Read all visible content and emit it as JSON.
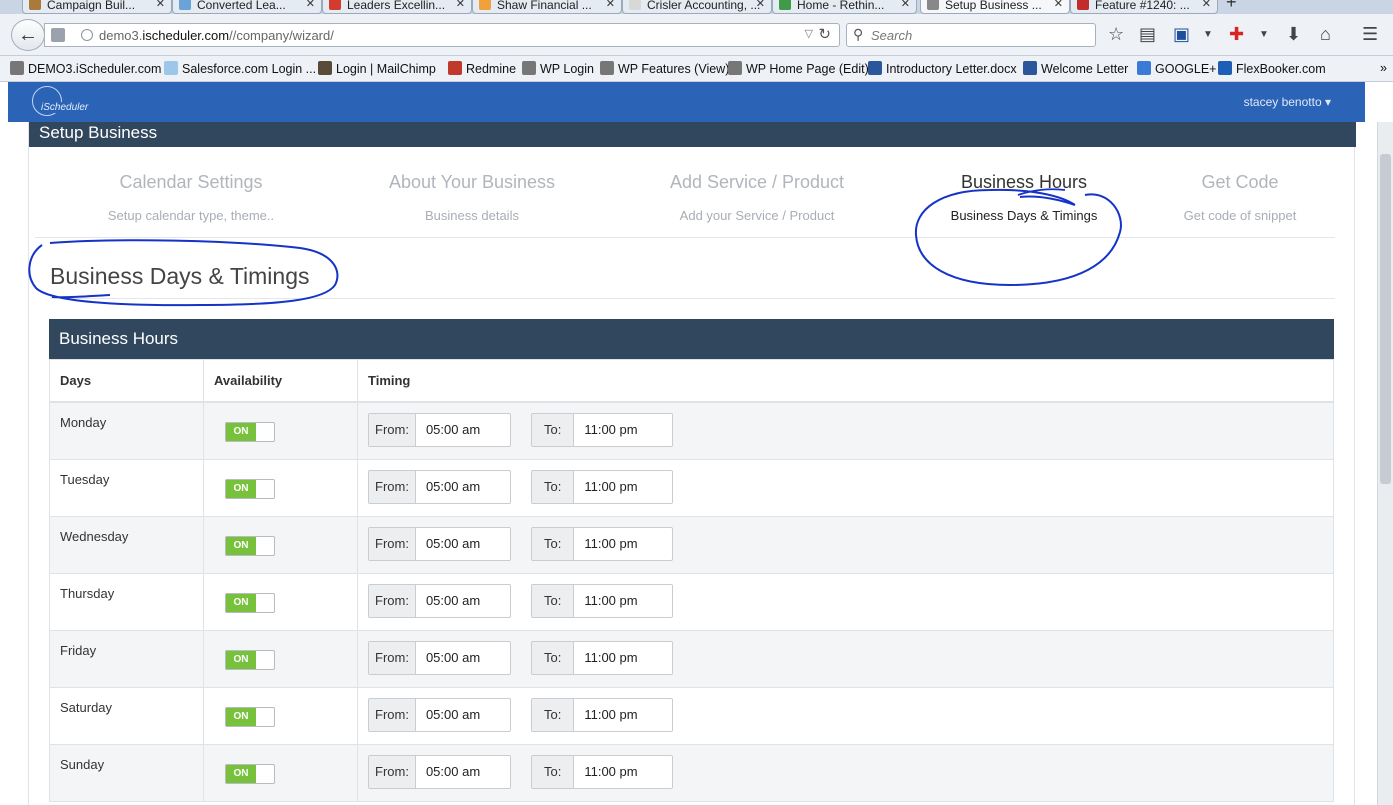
{
  "browser": {
    "tabs": [
      {
        "title": "Campaign Buil...",
        "fav": "#a97a3c"
      },
      {
        "title": "Converted Lea...",
        "fav": "#6aa3d8"
      },
      {
        "title": "Leaders Excellin...",
        "fav": "#d33b2c"
      },
      {
        "title": "Shaw Financial ...",
        "fav": "#f0a13a"
      },
      {
        "title": "Crisler Accounting, ...",
        "fav": "#d8d8d8"
      },
      {
        "title": "Home - Rethin...",
        "fav": "#3f9a4a"
      },
      {
        "title": "Setup Business ...",
        "fav": "#888888"
      },
      {
        "title": "Feature #1240: ...",
        "fav": "#c12d2d"
      }
    ],
    "new_tab": "+",
    "url_host": "demo3.",
    "url_domain": "ischeduler.com",
    "url_path": "//company/wizard/",
    "search_placeholder": "Search",
    "bookmarks": [
      {
        "label": "DEMO3.iScheduler.com",
        "color": "#777777"
      },
      {
        "label": "Salesforce.com Login ...",
        "color": "#9cc7e8"
      },
      {
        "label": "Login | MailChimp",
        "color": "#5a4a3a"
      },
      {
        "label": "Redmine",
        "color": "#c0392b"
      },
      {
        "label": "WP Login",
        "color": "#777777"
      },
      {
        "label": "WP Features (View)",
        "color": "#777777"
      },
      {
        "label": "WP Home Page (Edit)",
        "color": "#777777"
      },
      {
        "label": "Introductory Letter.docx",
        "color": "#2b579a"
      },
      {
        "label": "Welcome Letter",
        "color": "#2b579a"
      },
      {
        "label": "GOOGLE+",
        "color": "#3b7bd8"
      },
      {
        "label": "FlexBooker.com",
        "color": "#1d5fb8"
      }
    ]
  },
  "app": {
    "logo_text": "iScheduler",
    "user_name": "stacey benotto",
    "header_color": "#2b63b6",
    "accent": "#31475e"
  },
  "page": {
    "title": "Setup Business",
    "section_title": "Business Days & Timings"
  },
  "steps": [
    {
      "title": "Calendar Settings",
      "desc": "Setup calendar type, theme.."
    },
    {
      "title": "About Your Business",
      "desc": "Business details"
    },
    {
      "title": "Add Service / Product",
      "desc": "Add your Service / Product"
    },
    {
      "title": "Business Hours",
      "desc": "Business Days & Timings",
      "active": true
    },
    {
      "title": "Get Code",
      "desc": "Get code of snippet"
    }
  ],
  "hours": {
    "panel_title": "Business Hours",
    "columns": [
      "Days",
      "Availability",
      "Timing"
    ],
    "from_label": "From:",
    "to_label": "To:",
    "rows": [
      {
        "day": "Monday",
        "status": "ON",
        "from": "05:00 am",
        "to": "11:00 pm"
      },
      {
        "day": "Tuesday",
        "status": "ON",
        "from": "05:00 am",
        "to": "11:00 pm"
      },
      {
        "day": "Wednesday",
        "status": "ON",
        "from": "05:00 am",
        "to": "11:00 pm"
      },
      {
        "day": "Thursday",
        "status": "ON",
        "from": "05:00 am",
        "to": "11:00 pm"
      },
      {
        "day": "Friday",
        "status": "ON",
        "from": "05:00 am",
        "to": "11:00 pm"
      },
      {
        "day": "Saturday",
        "status": "ON",
        "from": "05:00 am",
        "to": "11:00 pm"
      },
      {
        "day": "Sunday",
        "status": "ON",
        "from": "05:00 am",
        "to": "11:00 pm"
      }
    ]
  }
}
